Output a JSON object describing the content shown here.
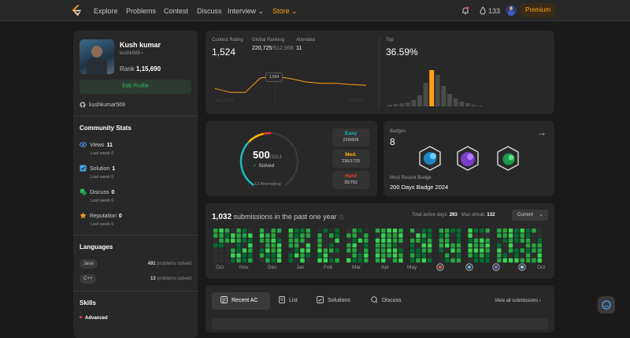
{
  "nav": {
    "links": [
      "Explore",
      "Problems",
      "Contest",
      "Discuss",
      "Interview",
      "Store"
    ],
    "streak": "133",
    "premium": "Premium"
  },
  "profile": {
    "name": "Kush kumar",
    "username": "kushk569",
    "rank_label": "Rank",
    "rank": "1,15,690",
    "edit": "Edit Profile",
    "github": "kushkumar569"
  },
  "community": {
    "title": "Community Stats",
    "items": [
      {
        "label": "Views",
        "value": "11",
        "sub_label": "Last week",
        "sub_value": "0",
        "color": "#4a9eff"
      },
      {
        "label": "Solution",
        "value": "1",
        "sub_label": "Last week",
        "sub_value": "0",
        "color": "#4aa8e8"
      },
      {
        "label": "Discuss",
        "value": "0",
        "sub_label": "Last week",
        "sub_value": "0",
        "color": "#2cbb5d"
      },
      {
        "label": "Reputation",
        "value": "0",
        "sub_label": "Last week",
        "sub_value": "0",
        "color": "#ffa116"
      }
    ]
  },
  "languages": {
    "title": "Languages",
    "items": [
      {
        "name": "Java",
        "count": "491",
        "suffix": "problems solved"
      },
      {
        "name": "C++",
        "count": "13",
        "suffix": "problems solved"
      }
    ]
  },
  "skills": {
    "title": "Skills",
    "advanced": "Advanced"
  },
  "contest": {
    "rating_label": "Contest Rating",
    "rating": "1,524",
    "global_label": "Global Ranking",
    "global": "220,725",
    "global_total": "/612,968",
    "attended_label": "Attended",
    "attended": "11",
    "tooltip": "1,594",
    "start_label": "Aug 2023",
    "end_label": "Jul 2024",
    "top_label": "Top",
    "top": "36.59%"
  },
  "chart_data": [
    {
      "type": "line",
      "title": "Contest Rating",
      "x": [
        1,
        2,
        3,
        4,
        5,
        6,
        7,
        8,
        9,
        10,
        11
      ],
      "values": [
        1500,
        1470,
        1470,
        1580,
        1594,
        1575,
        1550,
        1540,
        1540,
        1530,
        1524
      ],
      "ylim": [
        1400,
        1700
      ]
    },
    {
      "type": "bar",
      "title": "Top",
      "values": [
        2,
        3,
        4,
        5,
        8,
        14,
        30,
        46,
        40,
        26,
        16,
        10,
        6,
        4,
        2,
        1
      ],
      "highlight_index": 7,
      "ylim": [
        0,
        50
      ]
    }
  ],
  "solved": {
    "solved": "500",
    "total": "/3313",
    "label": "Solved",
    "attempting": "13 Attempting",
    "difficulties": [
      {
        "name": "Easy",
        "value": "229/828",
        "color": "#1cbaba",
        "fraction": 0.277
      },
      {
        "name": "Med.",
        "value": "236/1733",
        "color": "#ffb700",
        "fraction": 0.136
      },
      {
        "name": "Hard",
        "value": "35/752",
        "color": "#f63737",
        "fraction": 0.047
      }
    ]
  },
  "badges": {
    "label": "Badges",
    "count": "8",
    "recent_label": "Most Recent Badge",
    "recent": "200 Days Badge 2024",
    "items": [
      "badge-50-days",
      "badge-100-days",
      "badge-200-days"
    ]
  },
  "heatmap": {
    "count": "1,032",
    "text": "submissions in the past one year",
    "active_label": "Total active days:",
    "active": "293",
    "streak_label": "Max streak:",
    "streak": "132",
    "select": "Current",
    "months": [
      "Oct",
      "Nov",
      "Dec",
      "Jan",
      "Feb",
      "Mar",
      "Apr",
      "May",
      "Oct"
    ]
  },
  "recent": {
    "tabs": [
      "Recent AC",
      "List",
      "Solutions",
      "Discuss"
    ],
    "view_all": "View all submissions"
  }
}
